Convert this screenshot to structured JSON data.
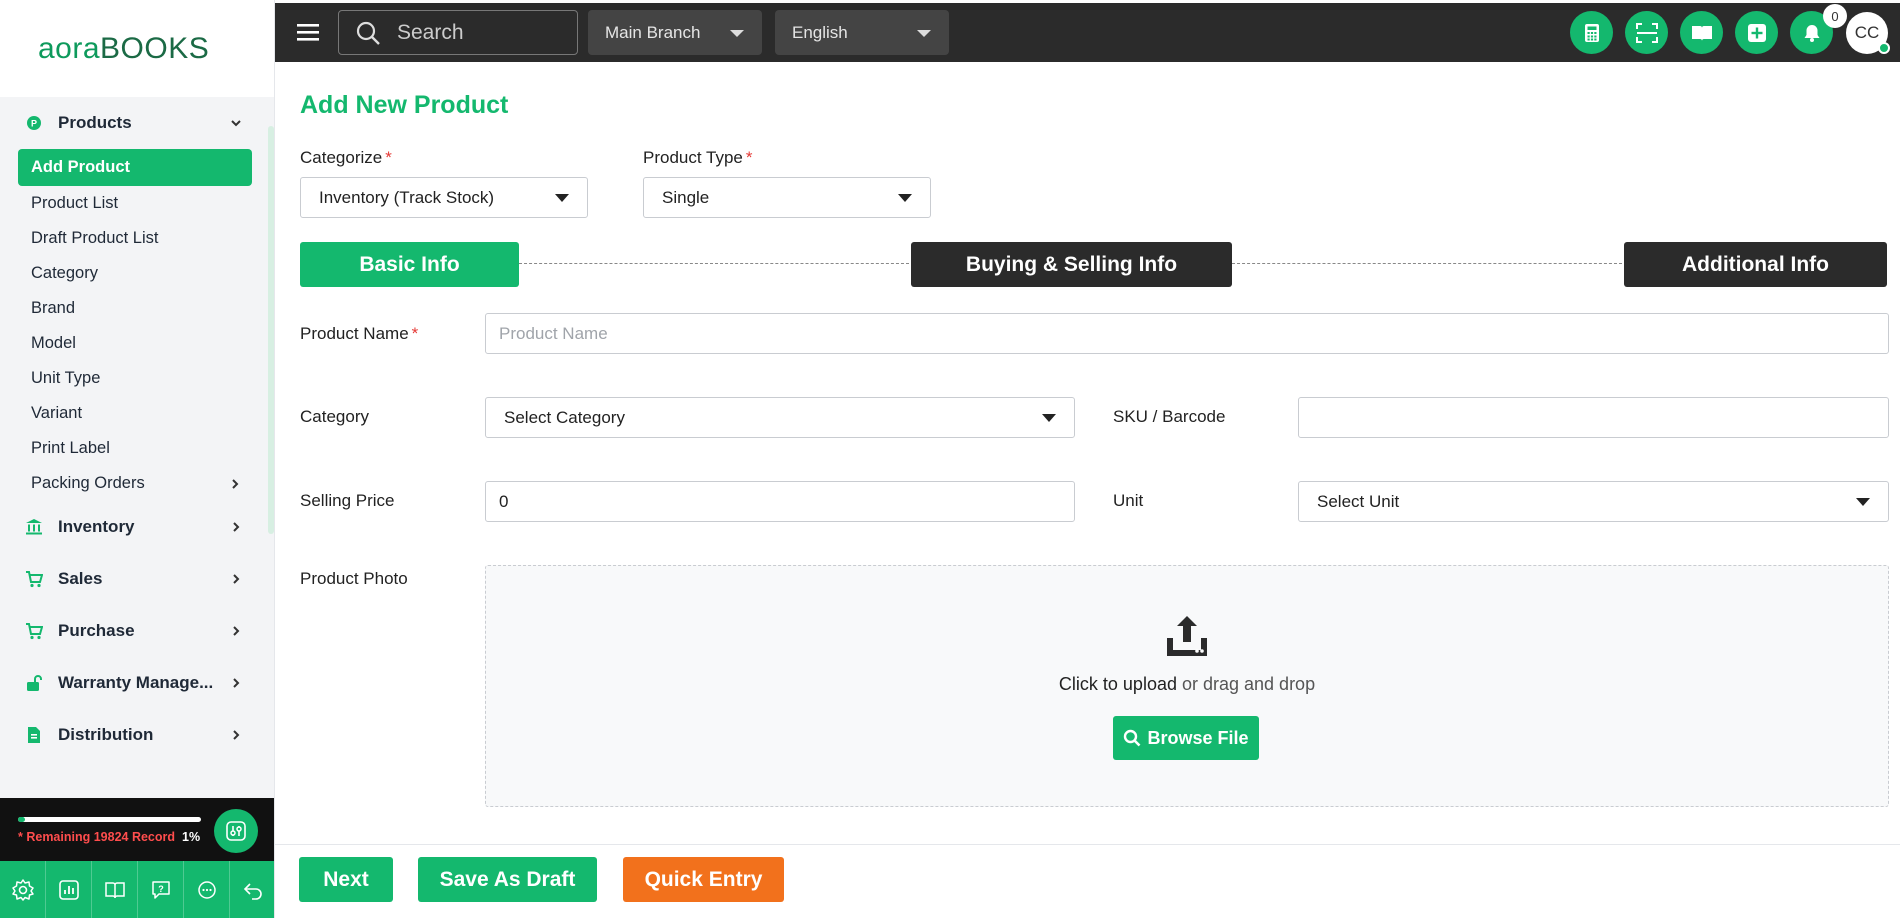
{
  "brand": {
    "logo_part1": "aora",
    "logo_part2": "BOOKS"
  },
  "topbar": {
    "search_placeholder": "Search",
    "branch": "Main Branch",
    "language": "English",
    "notification_count": "0",
    "avatar_initials": "CC"
  },
  "sidebar": {
    "products_group": "Products",
    "products_items": [
      {
        "label": "Add Product"
      },
      {
        "label": "Product List"
      },
      {
        "label": "Draft Product List"
      },
      {
        "label": "Category"
      },
      {
        "label": "Brand"
      },
      {
        "label": "Model"
      },
      {
        "label": "Unit Type"
      },
      {
        "label": "Variant"
      },
      {
        "label": "Print Label"
      },
      {
        "label": "Packing Orders"
      }
    ],
    "groups": [
      {
        "label": "Inventory"
      },
      {
        "label": "Sales"
      },
      {
        "label": "Purchase"
      },
      {
        "label": "Warranty Manage..."
      },
      {
        "label": "Distribution"
      }
    ],
    "records_remaining": "* Remaining 19824 Record",
    "records_percent": "1%",
    "records_progress_fraction": 0.01
  },
  "page": {
    "title": "Add New Product",
    "categorize_label": "Categorize",
    "categorize_value": "Inventory (Track Stock)",
    "product_type_label": "Product Type",
    "product_type_value": "Single",
    "steps": [
      "Basic Info",
      "Buying & Selling Info",
      "Additional Info"
    ],
    "product_name_label": "Product Name",
    "product_name_placeholder": "Product Name",
    "category_label": "Category",
    "category_value": "Select Category",
    "sku_label": "SKU / Barcode",
    "selling_price_label": "Selling Price",
    "selling_price_value": "0",
    "unit_label": "Unit",
    "unit_value": "Select Unit",
    "photo_label": "Product Photo",
    "upload_strong": "Click to upload",
    "upload_rest": " or drag and drop",
    "browse_label": "Browse File",
    "required_mark": "*"
  },
  "footer": {
    "next": "Next",
    "save_draft": "Save As Draft",
    "quick_entry": "Quick Entry"
  },
  "colors": {
    "accent": "#14b86e",
    "dark": "#2b2b2b",
    "orange": "#f2711c",
    "required": "#e53935"
  }
}
